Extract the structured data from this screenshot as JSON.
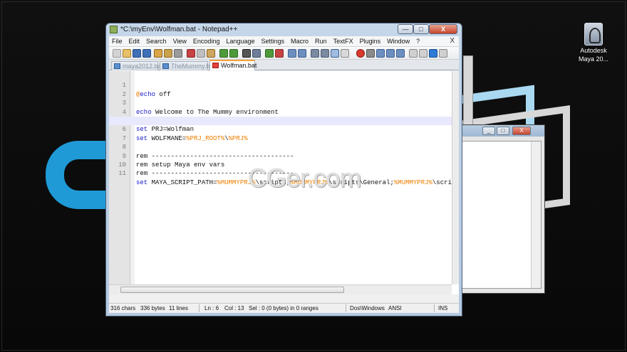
{
  "window": {
    "title": "*C:\\myEnv\\Wolfman.bat - Notepad++",
    "minimize": "—",
    "maximize": "□",
    "close": "X"
  },
  "menu": [
    "File",
    "Edit",
    "Search",
    "View",
    "Encoding",
    "Language",
    "Settings",
    "Macro",
    "Run",
    "TextFX",
    "Plugins",
    "Window",
    "?"
  ],
  "menu_close": "X",
  "tabs": [
    {
      "label": "maya2012.bat",
      "active": false
    },
    {
      "label": "TheMummy.bat",
      "active": false
    },
    {
      "label": "Wolfman.bat",
      "active": true
    }
  ],
  "editor": {
    "line_numbers": [
      "1",
      "2",
      "3",
      "4",
      "5",
      "6",
      "7",
      "8",
      "9",
      "10",
      "11"
    ],
    "current_line": 6,
    "lines": {
      "l1_at": "@",
      "l1_kw": "echo",
      "l1_rest": " off",
      "l3_kw": "echo",
      "l3_rest": " Welcome to The Mummy environment",
      "l5_kw": "set",
      "l5_rest": " PRJ=Wolfman",
      "l6_kw": "set",
      "l6_rest": " WOLFMANE=",
      "l6_var1": "%PRJ_ROOT%",
      "l6_sep": "\\",
      "l6_var2": "%PRJ%",
      "l8_kw": "rem",
      "l8_rest": " -------------------------------------",
      "l9_kw": "rem",
      "l9_rest": " setup Maya env vars",
      "l10_kw": "rem",
      "l10_rest": " -------------------------------------",
      "l11_kw": "set",
      "l11_a": " MAYA_SCRIPT_PATH=",
      "l11_v1": "%MUMMYPRJ%",
      "l11_b": "\\scripts;",
      "l11_v2": "%MUMMYPRJ%",
      "l11_c": "\\scripts\\General;",
      "l11_v3": "%MUMMYPRJ%",
      "l11_d": "\\scri"
    }
  },
  "status": {
    "chars": "316 chars",
    "bytes": "336 bytes",
    "lines": "11 lines",
    "ln": "Ln : 6",
    "col": "Col : 13",
    "sel": "Sel : 0 (0 bytes) in 0 ranges",
    "eol": "Dos\\Windows",
    "encoding": "ANSI",
    "mode": "INS"
  },
  "desktop_icon": {
    "label_line1": "Autodesk",
    "label_line2": "Maya 20..."
  },
  "watermark": "CGer.com",
  "colors": {
    "keyword": "#1717c8",
    "variable": "#ee7f00",
    "comment": "#008000",
    "current_line": "#e8e8ff",
    "brand_blue": "#1f9ad6"
  }
}
